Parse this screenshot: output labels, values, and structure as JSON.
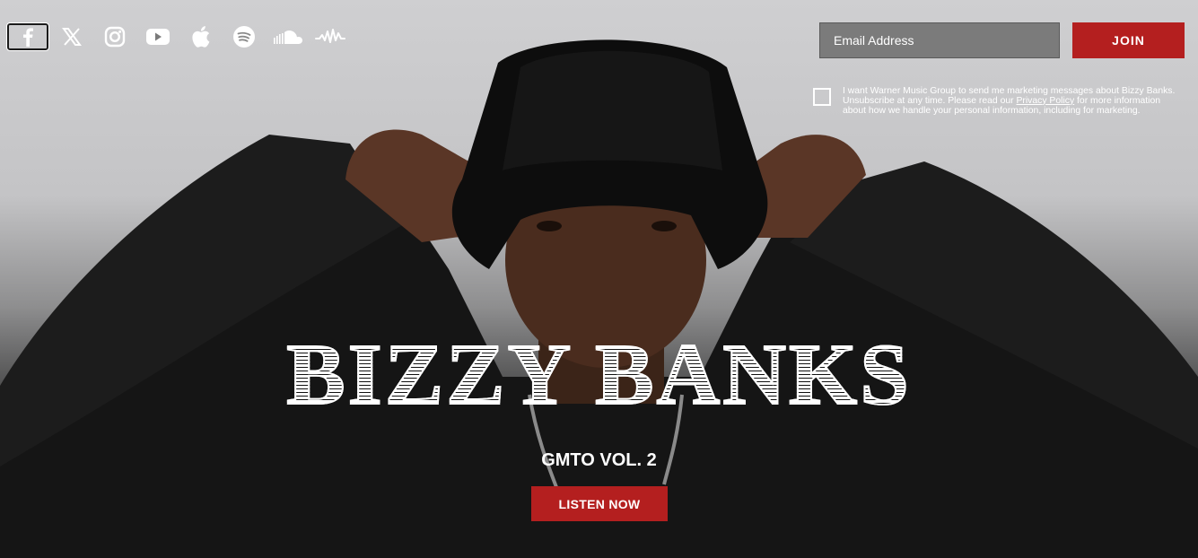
{
  "social": {
    "items": [
      {
        "name": "facebook-icon"
      },
      {
        "name": "x-icon"
      },
      {
        "name": "instagram-icon"
      },
      {
        "name": "youtube-icon"
      },
      {
        "name": "apple-music-icon"
      },
      {
        "name": "spotify-icon"
      },
      {
        "name": "soundcloud-icon"
      },
      {
        "name": "audiomack-icon"
      }
    ]
  },
  "signup": {
    "email_placeholder": "Email Address",
    "join_label": "JOIN",
    "consent_prefix": "I want Warner Music Group to send me marketing messages about Bizzy Banks. Unsubscribe at any time. Please read our ",
    "privacy_link": "Privacy Policy",
    "consent_suffix": " for more information about how we handle your personal information, including for marketing."
  },
  "hero": {
    "artist": "BIZZY BANKS",
    "release": "GMTO VOL. 2",
    "cta_label": "LISTEN NOW"
  },
  "colors": {
    "accent": "#b41f1f"
  }
}
